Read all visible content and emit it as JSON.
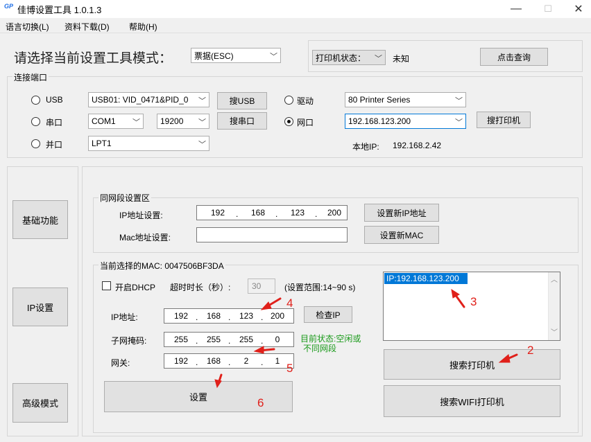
{
  "window": {
    "logo": "GP",
    "title": "佳博设置工具 1.0.1.3",
    "minimize": "—",
    "maximize": "☐",
    "close": "✕"
  },
  "menu": [
    "语言切换(L)",
    "资料下载(D)",
    "帮助(H)"
  ],
  "header": {
    "mode_label": "请选择当前设置工具模式：",
    "mode_value": "票据(ESC)",
    "printer_status_select": "打印机状态：",
    "printer_status_value": "未知",
    "query_button": "点击查询"
  },
  "port": {
    "group_title": "连接端口",
    "usb_label": "USB",
    "usb_value": "USB01: VID_0471&PID_0",
    "search_usb": "搜USB",
    "driver_label": "驱动",
    "driver_value": "80 Printer Series",
    "serial_label": "串口",
    "com_value": "COM1",
    "baud_value": "19200",
    "search_serial": "搜串口",
    "network_label": "网口",
    "network_value": "192.168.123.200",
    "search_printer": "搜打印机",
    "parallel_label": "并口",
    "lpt_value": "LPT1",
    "local_ip_label": "本地IP:",
    "local_ip_value": "192.168.2.42"
  },
  "sidebar": {
    "basic": "基础功能",
    "ip": "IP设置",
    "advanced": "高级模式"
  },
  "same_segment": {
    "title": "同网段设置区",
    "ip_label": "IP地址设置:",
    "ip": [
      "192",
      "168",
      "123",
      "200"
    ],
    "set_ip_button": "设置新IP地址",
    "mac_label": "Mac地址设置:",
    "mac_value": "",
    "set_mac_button": "设置新MAC"
  },
  "current": {
    "title": "当前选择的MAC: 0047506BF3DA",
    "dhcp_label": "开启DHCP",
    "timeout_label": "超时时长（秒）:",
    "timeout_value": "30",
    "range_label": "(设置范围:14~90 s)",
    "ip_label": "IP地址:",
    "ip": [
      "192",
      "168",
      "123",
      "200"
    ],
    "check_ip_button": "检查IP",
    "mask_label": "子网掩码:",
    "mask": [
      "255",
      "255",
      "255",
      "0"
    ],
    "status_line1": "目前状态:空闲或",
    "status_line2": "不同网段",
    "gateway_label": "网关:",
    "gateway": [
      "192",
      "168",
      "2",
      "1"
    ],
    "set_button": "设置"
  },
  "search": {
    "list_items": [
      "IP:192.168.123.200"
    ],
    "search_printer_button": "搜索打印机",
    "search_wifi_button": "搜索WIFI打印机"
  },
  "annotations": [
    "2",
    "3",
    "4",
    "5",
    "6"
  ],
  "colors": {
    "accent": "#0078d7",
    "annotation": "#e0201a",
    "status_text": "#1a9a1a"
  }
}
